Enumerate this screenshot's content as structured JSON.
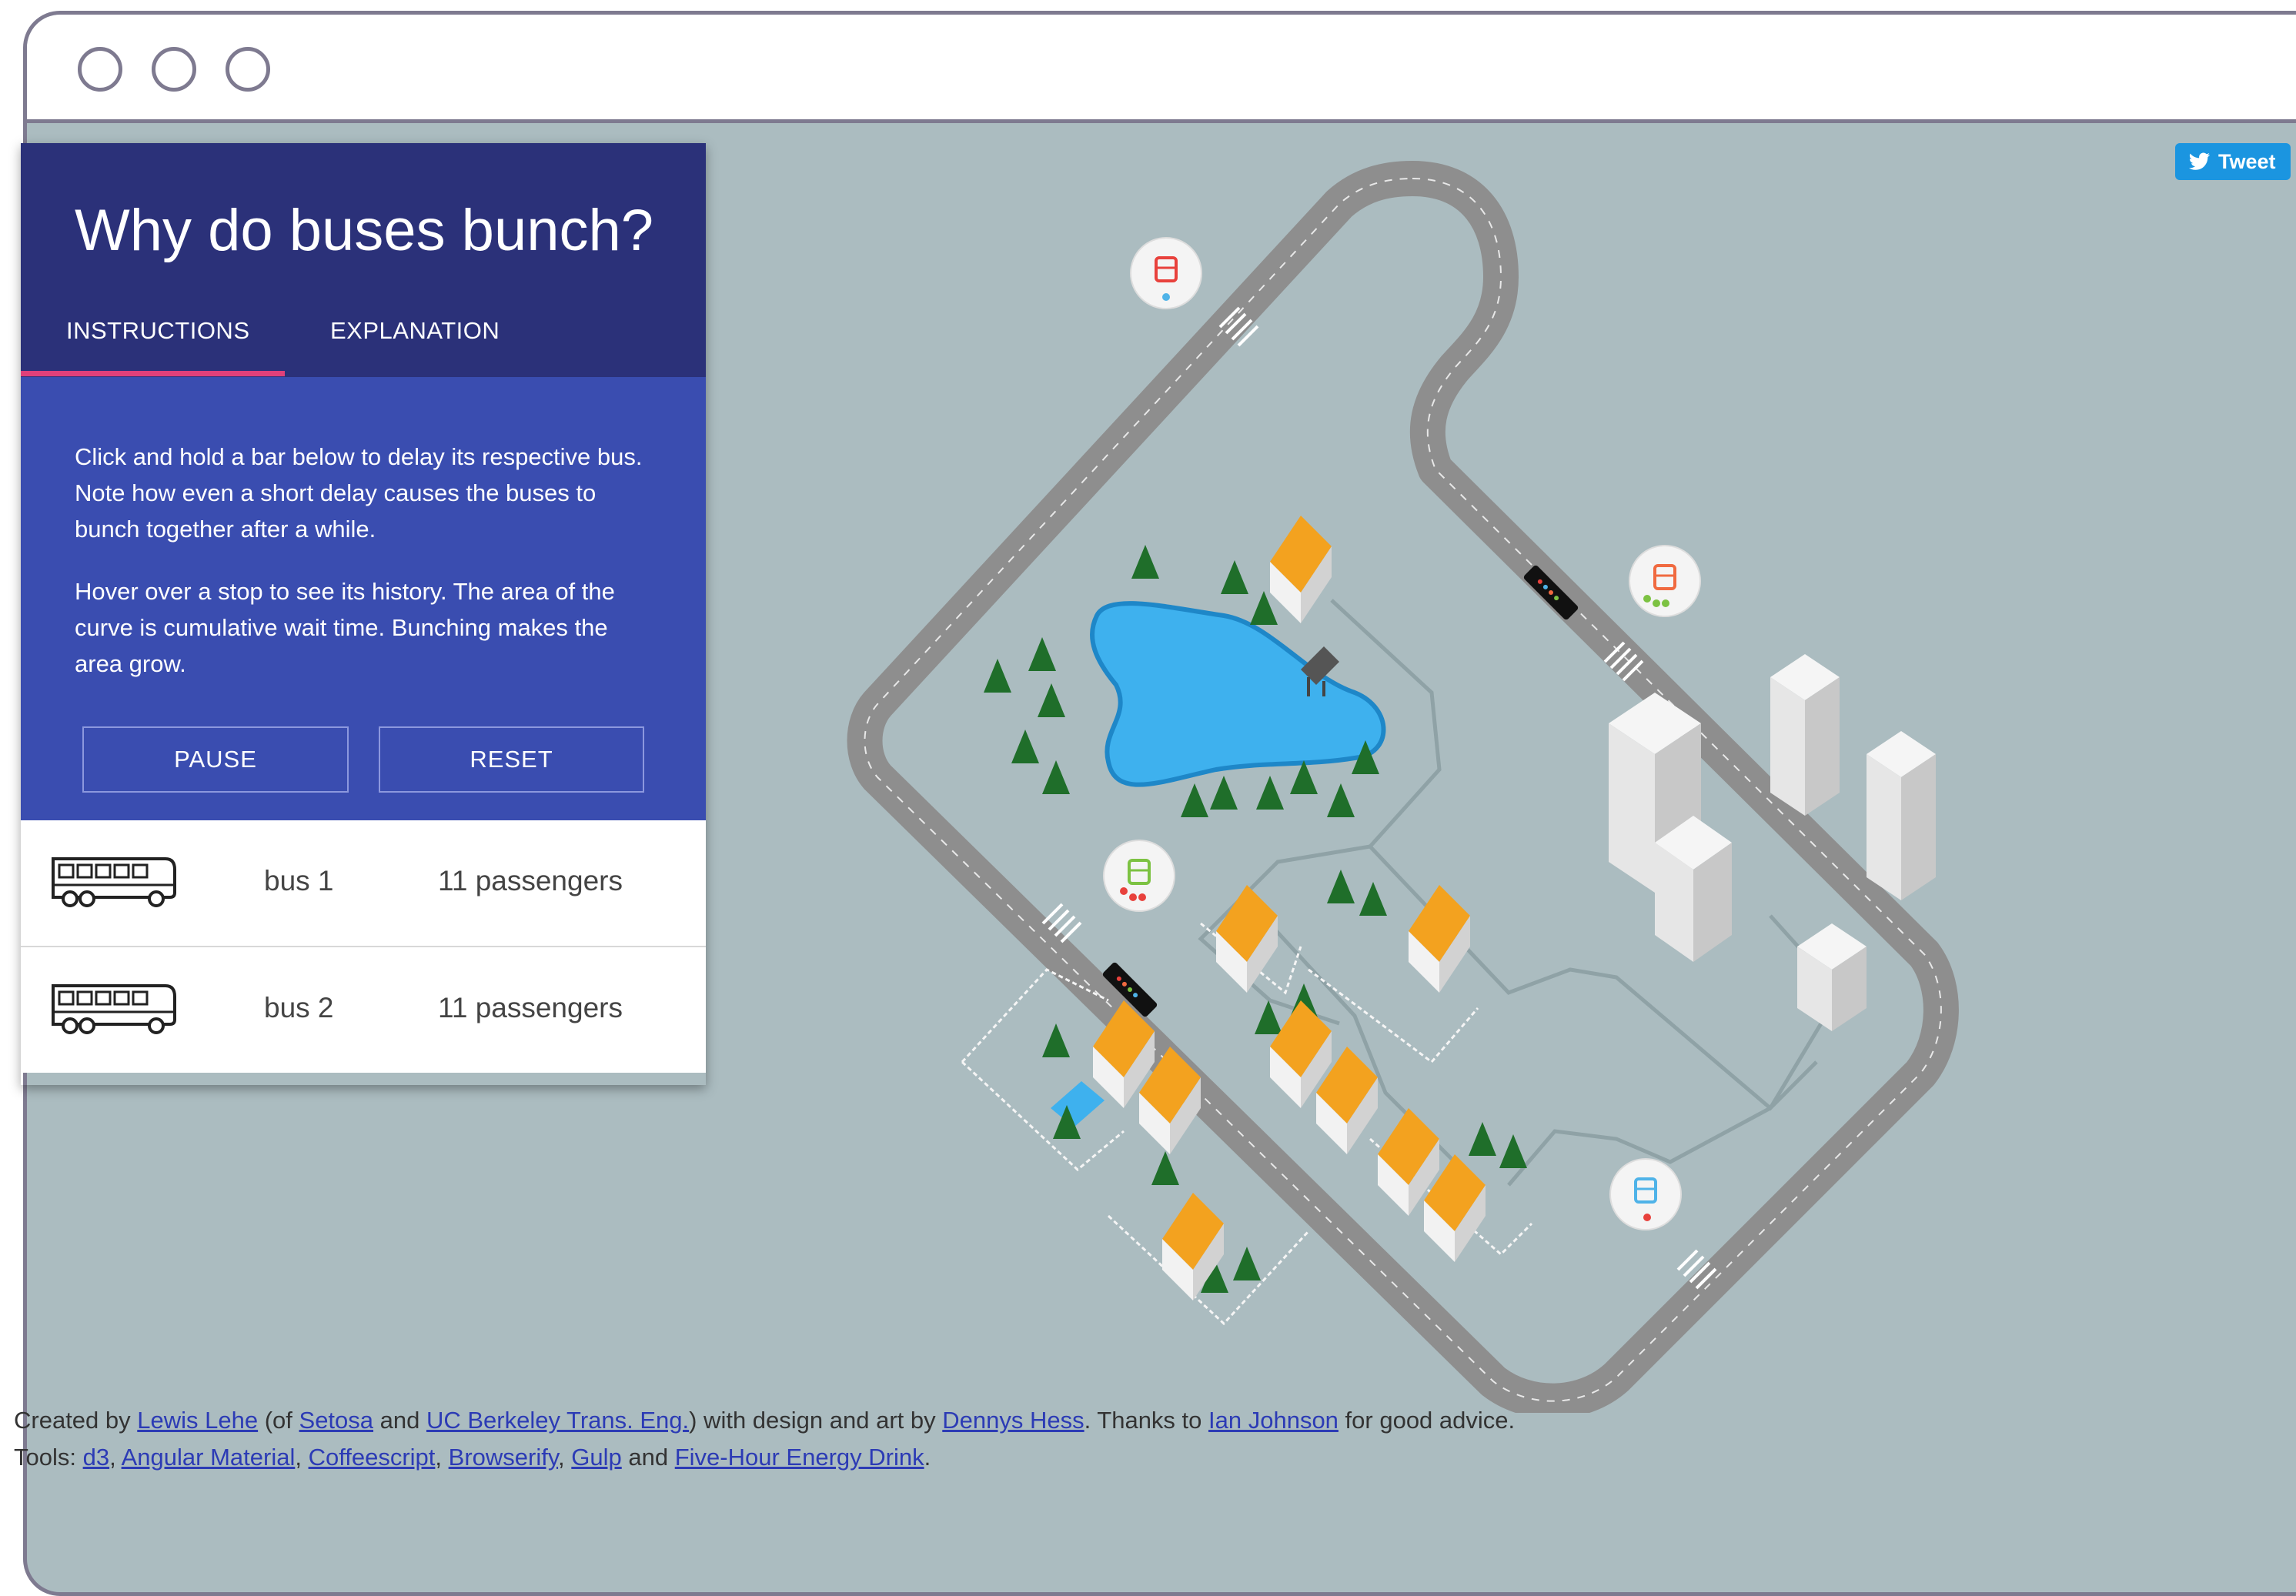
{
  "window": {
    "controls": [
      "close",
      "minimize",
      "maximize"
    ]
  },
  "panel": {
    "title": "Why do buses bunch?",
    "tabs": [
      {
        "label": "INSTRUCTIONS",
        "active": true
      },
      {
        "label": "EXPLANATION",
        "active": false
      }
    ],
    "instructions": [
      "Click and hold a bar below to delay its respective bus. Note how even a short delay causes the buses to bunch together after a while.",
      "Hover over a stop to see its history. The area of the curve is cumulative wait time. Bunching makes the area grow."
    ],
    "buttons": {
      "pause": "PAUSE",
      "reset": "RESET"
    },
    "buses": [
      {
        "name": "bus 1",
        "passengers": "11 passengers",
        "icon": "bus-icon"
      },
      {
        "name": "bus 2",
        "passengers": "11 passengers",
        "icon": "bus-icon"
      }
    ]
  },
  "tweet": {
    "label": "Tweet",
    "icon": "twitter-bird-icon"
  },
  "credits": {
    "line1": {
      "t1": "Created by ",
      "a1": "Lewis Lehe",
      "t2": " (of ",
      "a2": "Setosa",
      "t3": " and ",
      "a3": "UC Berkeley Trans. Eng.",
      "t4": ") with design and art by ",
      "a4": "Dennys Hess",
      "t5": ". Thanks to ",
      "a5": "Ian Johnson",
      "t6": " for good advice."
    },
    "line2": {
      "t1": "Tools: ",
      "tools": [
        "d3",
        "Angular Material",
        "Coffeescript",
        "Browserify",
        "Gulp",
        "Five-Hour Energy Drink"
      ],
      "sep": ", ",
      "and": " and ",
      "end": "."
    }
  },
  "colors": {
    "panel_header": "#2b3179",
    "panel_body": "#3a4db0",
    "tab_indicator": "#e0407a",
    "map_background": "#abbcc0",
    "road": "#8e8e8e",
    "lake": "#3eb1ee",
    "tree": "#1f6e2a",
    "roof": "#f3a21f",
    "link": "#2c3bb5",
    "stop_colors": [
      "#e8413c",
      "#f06a40",
      "#7cc242",
      "#4fb3e8"
    ]
  }
}
